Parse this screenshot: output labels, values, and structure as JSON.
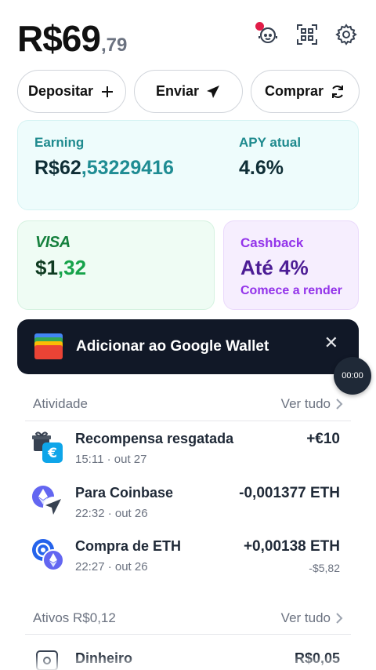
{
  "header": {
    "balance_main": "R$69",
    "balance_cents": ",79",
    "icons": [
      "support-agent-icon",
      "qr-scan-icon",
      "gear-icon"
    ]
  },
  "actions": [
    {
      "label": "Depositar",
      "icon": "plus-icon"
    },
    {
      "label": "Enviar",
      "icon": "send-icon"
    },
    {
      "label": "Comprar",
      "icon": "refresh-icon"
    }
  ],
  "earning": {
    "label": "Earning",
    "value_int": "R$62",
    "value_dec": ",53229416",
    "apy_label": "APY atual",
    "apy_value": "4.6%"
  },
  "visa": {
    "logo": "VISA",
    "value_int": "$1",
    "value_dec": ",32"
  },
  "cashback": {
    "label": "Cashback",
    "value": "Até 4%",
    "cta": "Comece a render"
  },
  "wallet_banner": {
    "text": "Adicionar ao Google Wallet",
    "close": "✕"
  },
  "timer": "00:00",
  "activity": {
    "title": "Atividade",
    "see_all": "Ver tudo",
    "items": [
      {
        "title": "Recompensa resgatada",
        "time": "15:11 · out 27",
        "amount": "+€10",
        "sub": ""
      },
      {
        "title": "Para Coinbase",
        "time": "22:32 · out 26",
        "amount": "-0,001377 ETH",
        "sub": ""
      },
      {
        "title": "Compra de ETH",
        "time": "22:27 · out 26",
        "amount": "+0,00138 ETH",
        "sub": "-$5,82"
      }
    ]
  },
  "assets": {
    "title": "Ativos R$0,12",
    "see_all": "Ver tudo",
    "first_item": {
      "title": "Dinheiro",
      "amount": "R$0,05"
    }
  },
  "colors": {
    "earning_bg": "#eefcfc",
    "visa_bg": "#effcf4",
    "cashback_bg": "#f6eefe",
    "banner_bg": "#111827"
  }
}
